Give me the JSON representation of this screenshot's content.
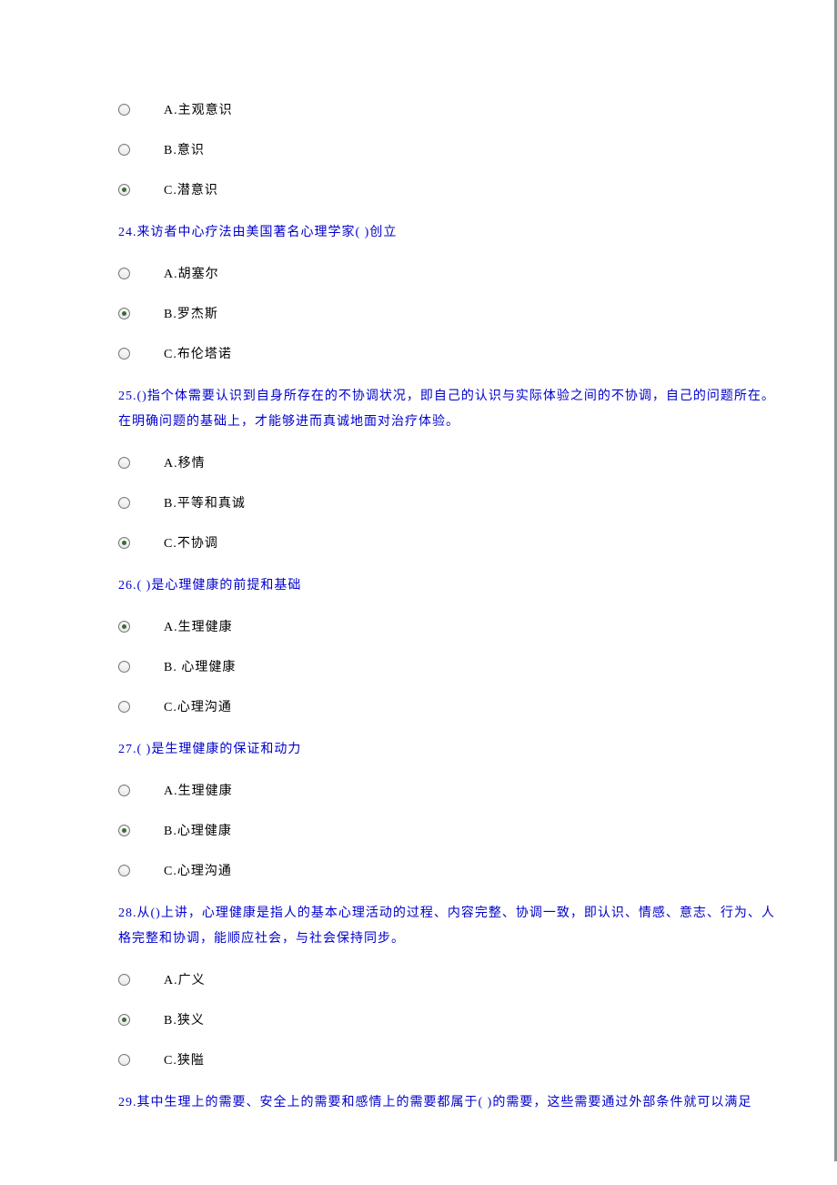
{
  "q23_continued": {
    "options": [
      {
        "letter": "A",
        "text": "主观意识",
        "selected": false
      },
      {
        "letter": "B",
        "text": "意识",
        "selected": false
      },
      {
        "letter": "C",
        "text": "潜意识",
        "selected": true
      }
    ]
  },
  "questions": [
    {
      "number": "24",
      "text": "来访者中心疗法由美国著名心理学家( )创立",
      "options": [
        {
          "letter": "A",
          "text": "胡塞尔",
          "selected": false
        },
        {
          "letter": "B",
          "text": "罗杰斯",
          "selected": true
        },
        {
          "letter": "C",
          "text": "布伦塔诺",
          "selected": false
        }
      ]
    },
    {
      "number": "25",
      "text": "()指个体需要认识到自身所存在的不协调状况，即自己的认识与实际体验之间的不协调，自己的问题所在。在明确问题的基础上，才能够进而真诚地面对治疗体验。",
      "options": [
        {
          "letter": "A",
          "text": "移情",
          "selected": false
        },
        {
          "letter": "B",
          "text": "平等和真诚",
          "selected": false
        },
        {
          "letter": "C",
          "text": "不协调",
          "selected": true
        }
      ]
    },
    {
      "number": "26",
      "text": "( )是心理健康的前提和基础",
      "options": [
        {
          "letter": "A",
          "text": "生理健康",
          "selected": true
        },
        {
          "letter": "B",
          "text": " 心理健康",
          "selected": false
        },
        {
          "letter": "C",
          "text": "心理沟通",
          "selected": false
        }
      ]
    },
    {
      "number": "27",
      "text": "( )是生理健康的保证和动力",
      "options": [
        {
          "letter": "A",
          "text": "生理健康",
          "selected": false
        },
        {
          "letter": "B",
          "text": "心理健康",
          "selected": true
        },
        {
          "letter": "C",
          "text": "心理沟通",
          "selected": false
        }
      ]
    },
    {
      "number": "28",
      "text": "从()上讲，心理健康是指人的基本心理活动的过程、内容完整、协调一致，即认识、情感、意志、行为、人格完整和协调，能顺应社会，与社会保持同步。",
      "options": [
        {
          "letter": "A",
          "text": "广义",
          "selected": false
        },
        {
          "letter": "B",
          "text": "狭义",
          "selected": true
        },
        {
          "letter": "C",
          "text": "狭隘",
          "selected": false
        }
      ]
    },
    {
      "number": "29",
      "text": "其中生理上的需要、安全上的需要和感情上的需要都属于( )的需要，这些需要通过外部条件就可以满足",
      "options": []
    }
  ]
}
